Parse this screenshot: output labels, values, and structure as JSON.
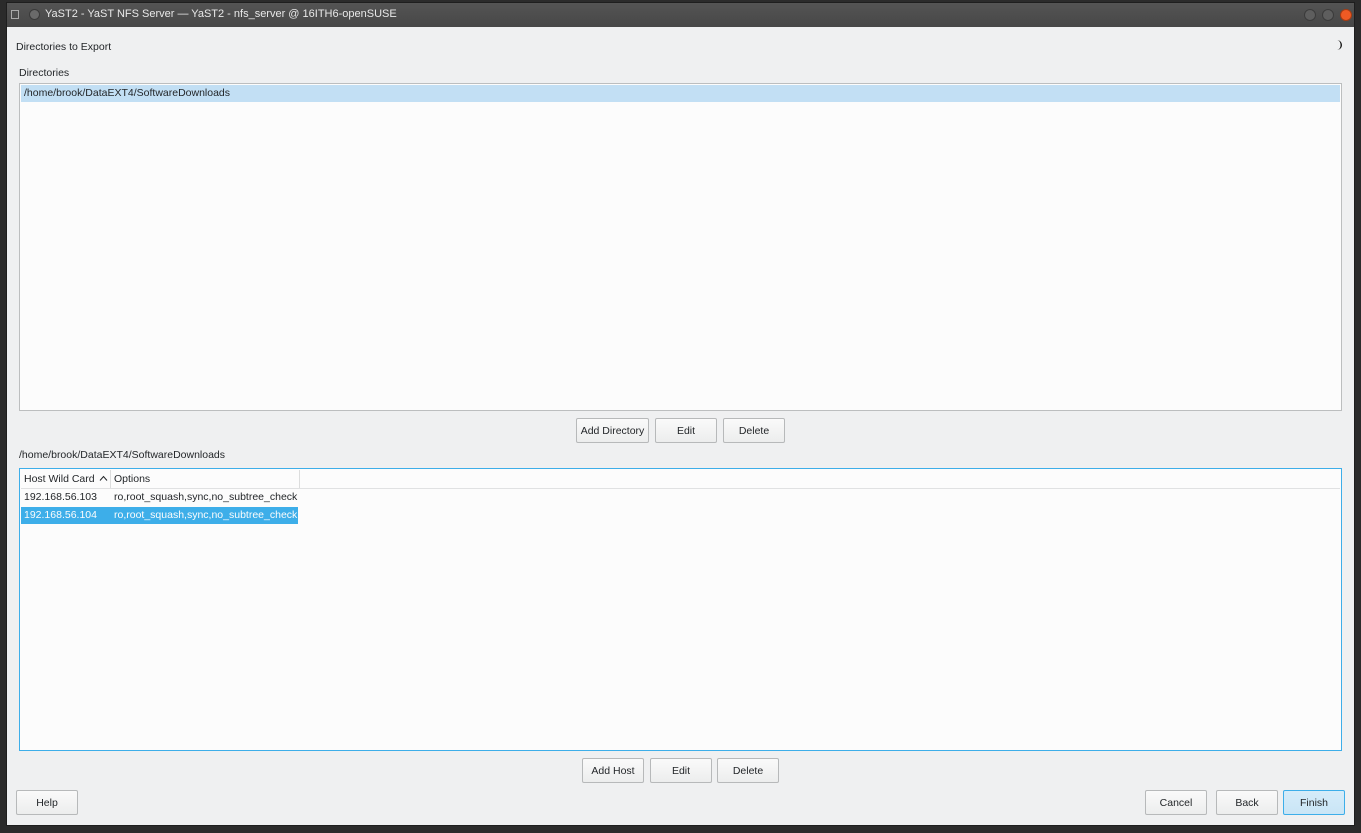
{
  "window": {
    "title": "YaST2 - YaST NFS Server — YaST2 - nfs_server @ 16ITH6-openSUSE"
  },
  "page": {
    "heading": "Directories to Export"
  },
  "directories": {
    "label": "Directories",
    "items": [
      "/home/brook/DataEXT4/SoftwareDownloads"
    ],
    "selected_index": 0,
    "buttons": {
      "add": "Add Directory",
      "edit": "Edit",
      "delete": "Delete"
    }
  },
  "hosts": {
    "label": "/home/brook/DataEXT4/SoftwareDownloads",
    "columns": [
      "Host Wild Card",
      "Options"
    ],
    "rows": [
      {
        "host": "192.168.56.103",
        "options": "ro,root_squash,sync,no_subtree_check"
      },
      {
        "host": "192.168.56.104",
        "options": "ro,root_squash,sync,no_subtree_check"
      }
    ],
    "selected_index": 1,
    "buttons": {
      "add": "Add Host",
      "edit": "Edit",
      "delete": "Delete"
    }
  },
  "footer": {
    "help": "Help",
    "cancel": "Cancel",
    "back": "Back",
    "finish": "Finish"
  },
  "icons": {
    "sort": "chevron-up-icon",
    "theme": "moon-icon"
  },
  "colors": {
    "accent": "#3daee9",
    "selection_inactive": "#c2dff4",
    "close": "#ee5a24"
  }
}
